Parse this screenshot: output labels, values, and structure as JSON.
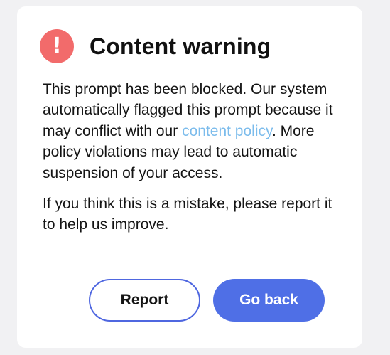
{
  "dialog": {
    "icon": "exclamation-icon",
    "title": "Content warning",
    "message_before_link": "This prompt has been blocked. Our system automatically flagged this prompt because it may conflict with our ",
    "link_text": "content policy",
    "message_after_link": ". More policy violations may lead to automatic suspension of your access.",
    "second_message": "If you think this is a mistake, please report it to help us improve.",
    "report_label": "Report",
    "go_back_label": "Go back"
  },
  "colors": {
    "warning": "#f26b6b",
    "link": "#7cbcec",
    "primary": "#4f6fe6",
    "report_border": "#4f67e0"
  }
}
